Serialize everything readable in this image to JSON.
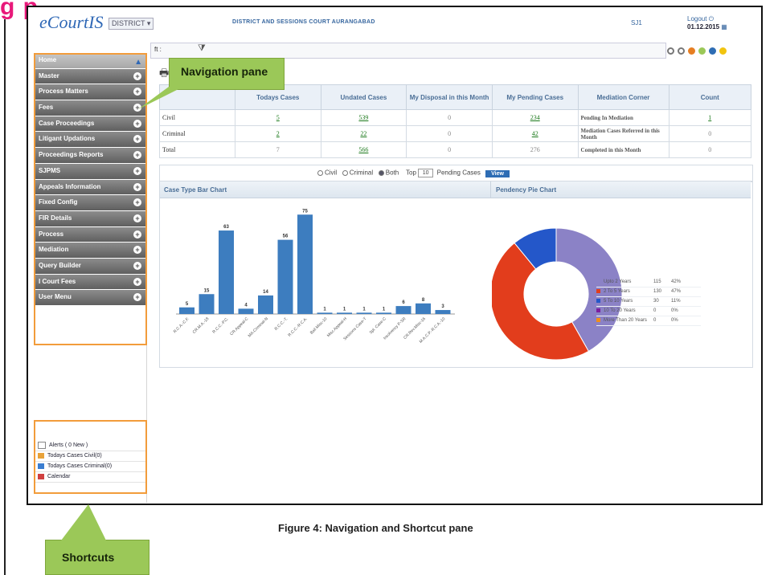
{
  "page_heading_fragment": "g p",
  "header": {
    "logo": "eCourtIS",
    "district_select": "DISTRICT",
    "court_title": "DISTRICT AND SESSIONS COURT AURANGABAD",
    "user_code": "SJ1",
    "logout": "Logout",
    "date": "01.12.2015"
  },
  "breadcrumb": "ft :",
  "theme_colors": [
    "#ffffff",
    "#ffffff",
    "#e67e22",
    "#9bc858",
    "#2e6db4",
    "#f1c40f"
  ],
  "sidebar": {
    "home": "Home",
    "items": [
      "Master",
      "Process Matters",
      "Fees",
      "Case Proceedings",
      "Litigant Updations",
      "Proceedings Reports",
      "SJPMS",
      "Appeals Information",
      "Fixed Config",
      "FIR Details",
      "Process",
      "Mediation",
      "Query Builder",
      "I Court Fees",
      "User Menu"
    ]
  },
  "shortcuts": {
    "items": [
      "Alerts ( 0 New )",
      "Todays Cases Civil(0)",
      "Todays Cases Criminal(0)",
      "Calendar"
    ]
  },
  "table": {
    "headers": [
      "",
      "Todays Cases",
      "Undated Cases",
      "My Disposal in this Month",
      "My Pending Cases",
      "Mediation Corner",
      "Count"
    ],
    "rows": [
      {
        "label": "Civil",
        "today": "5",
        "undated": "539",
        "disposal": "0",
        "pending": "234",
        "med": "Pending In Mediation",
        "count": "1"
      },
      {
        "label": "Criminal",
        "today": "2",
        "undated": "22",
        "disposal": "0",
        "pending": "42",
        "med": "Mediation Cases Referred in this Month",
        "count": "0"
      },
      {
        "label": "Total",
        "today": "7",
        "undated": "566",
        "disposal": "0",
        "pending": "276",
        "med": "Completed in this Month",
        "count": "0"
      }
    ]
  },
  "filter": {
    "civil": "Civil",
    "criminal": "Criminal",
    "both": "Both",
    "top": "Top",
    "top_value": "10",
    "pending": "Pending Cases",
    "view": "View"
  },
  "bar_chart_title": "Case Type Bar Chart",
  "pie_chart_title": "Pendency Pie Chart",
  "chart_data": [
    {
      "type": "bar",
      "title": "Case Type Bar Chart",
      "categories": [
        "R.C.A.-C.F.",
        "CR.M.A.-18",
        "R.C.C.-P.C.",
        "CR.Appeal-C",
        "MA.Criminal-N",
        "R.C.C.-T.",
        "R.C.C.-R.C.A.",
        "Bail Misc-10",
        "Misc Appeal-H",
        "Sessions Case-T",
        "Spl. Case-C",
        "Insolvency P-SR",
        "CR.Rev.Misc-16",
        "M.A.C.P.-R.C.A.-10"
      ],
      "values": [
        5,
        15,
        63,
        4,
        14,
        56,
        75,
        1,
        1,
        1,
        1,
        6,
        8,
        3
      ],
      "ylim": [
        0,
        80
      ],
      "color": "#3d7dbf"
    },
    {
      "type": "pie",
      "title": "Pendency Pie Chart",
      "labels": [
        "Upto 2 Years",
        "2 To 5 Years",
        "5 To 10 Years",
        "10 To 20 Years",
        "More Than 20 Years"
      ],
      "values": [
        115,
        130,
        30,
        0,
        0
      ],
      "percent": [
        "42%",
        "47%",
        "11%",
        "0%",
        "0%"
      ],
      "colors": [
        "#8b82c6",
        "#e23d1c",
        "#2457c9",
        "#7c1fa0",
        "#f08e1a"
      ],
      "donut": true
    }
  ],
  "callouts": {
    "navigation": "Navigation pane",
    "shortcuts": "Shortcuts"
  },
  "caption": "Figure 4: Navigation and Shortcut pane"
}
